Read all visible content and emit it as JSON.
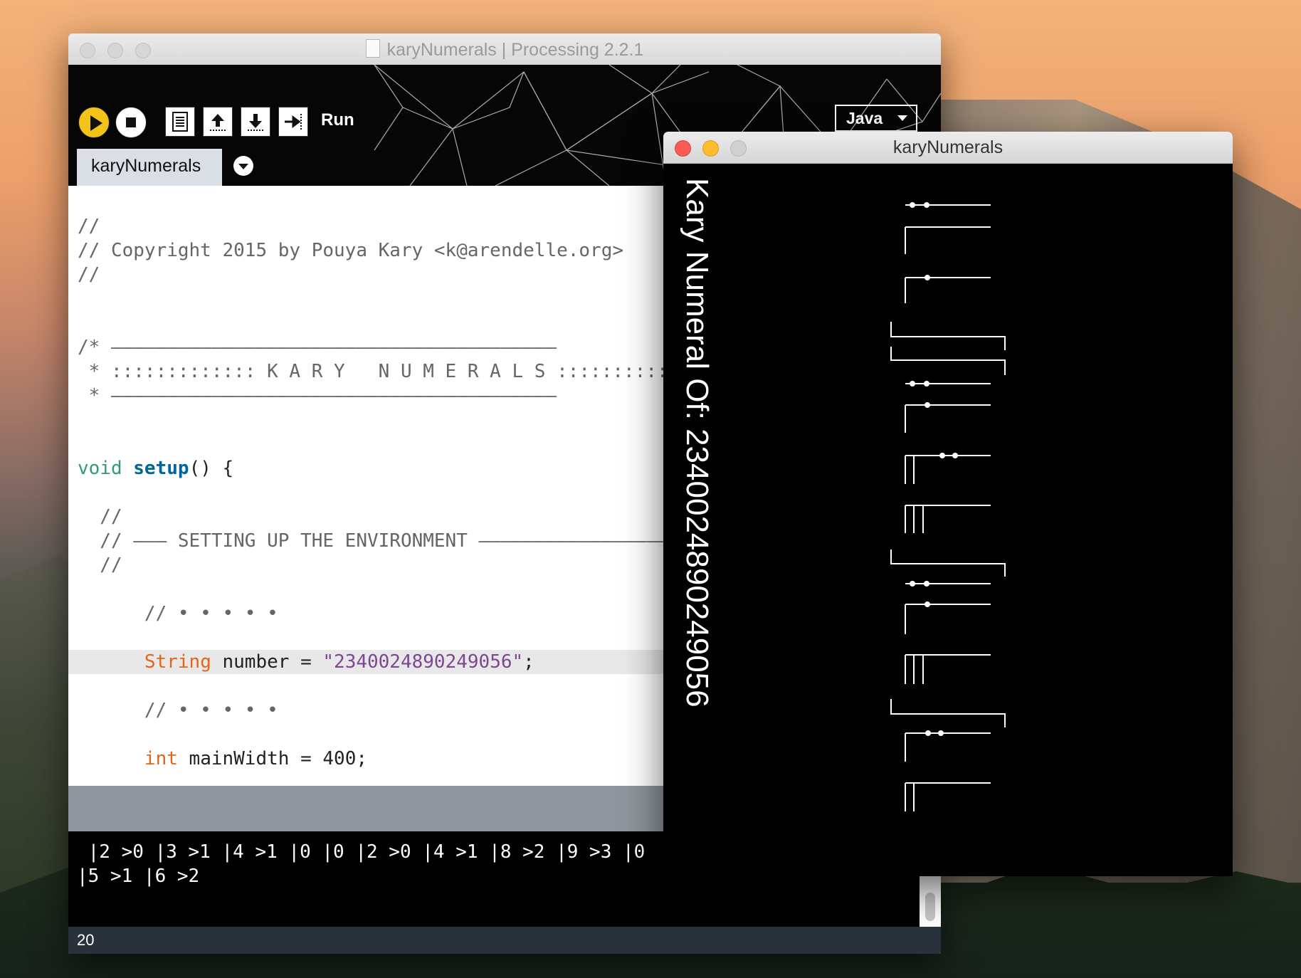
{
  "ide": {
    "window_title": "karyNumerals | Processing 2.2.1",
    "toolbar": {
      "run_label": "Run",
      "mode": "Java"
    },
    "tab": "karyNumerals",
    "code": {
      "l1": "//",
      "l2": "// Copyright 2015 by Pouya Kary <k@arendelle.org>",
      "l3": "//",
      "l4": "/* ————————————————————————————————————————",
      "l5": " * ::::::::::::: K A R Y   N U M E R A L S ::::::::::::",
      "l6": " * ————————————————————————————————————————",
      "l7_kw": "void",
      "l7_fn": "setup",
      "l7_rest": "() {",
      "l8": "  //",
      "l9": "  // ——— SETTING UP THE ENVIRONMENT ——————————————————",
      "l10": "  //",
      "l11": "      // • • • • •",
      "l12_type": "String",
      "l12_mid": " number = ",
      "l12_str": "\"2340024890249056\"",
      "l12_end": ";",
      "l13": "      // • • • • •",
      "l14_type": "int",
      "l14_rest": " mainWidth = 400;"
    },
    "console": {
      "line1": " |2 >0 |3 >1 |4 >1 |0 |0 |2 >0 |4 >1 |8 >2 |9 >3 |0",
      "line2": "|5 >1 |6 >2"
    },
    "status": "20"
  },
  "sketch": {
    "window_title": "karyNumerals",
    "vertical_label": "Kary Numeral Of: 2340024890249056",
    "line_color": "#ffffff",
    "background": "#000000"
  },
  "icons": {
    "run": "play-icon",
    "stop": "stop-icon",
    "new": "new-file-icon",
    "open": "open-icon",
    "save": "save-icon",
    "export": "export-icon"
  }
}
